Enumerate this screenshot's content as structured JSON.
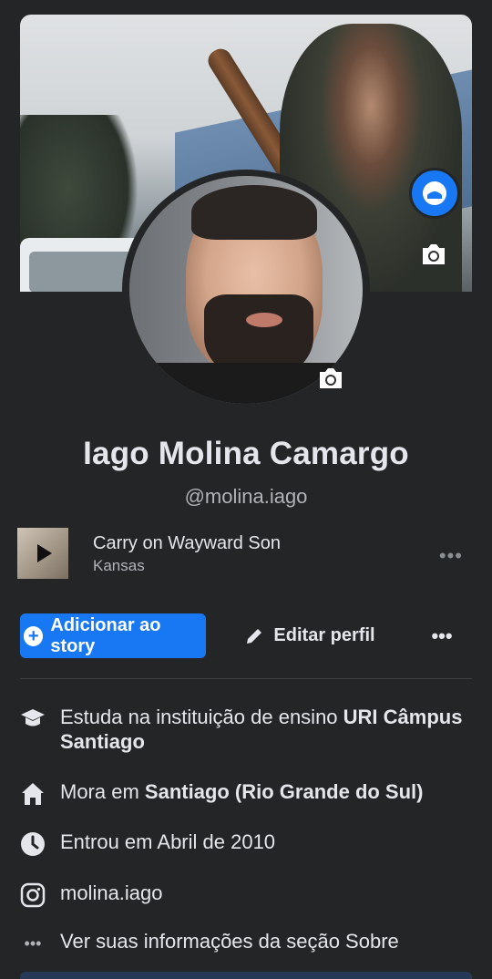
{
  "profile": {
    "name": "Iago Molina Camargo",
    "handle": "@molina.iago"
  },
  "music": {
    "song": "Carry on Wayward Son",
    "artist": "Kansas",
    "more_icon": "more-horizontal-icon"
  },
  "actions": {
    "add_story": "Adicionar ao story",
    "edit_profile": "Editar perfil",
    "more": "•••"
  },
  "info": {
    "study_prefix": "Estuda na instituição de ensino ",
    "study_place": "URI Câmpus Santiago",
    "lives_prefix": "Mora em ",
    "lives_place": "Santiago (Rio Grande do Sul)",
    "joined": "Entrou em Abril de 2010",
    "instagram": "molina.iago",
    "about": "Ver suas informações da seção Sobre"
  },
  "colors": {
    "background": "#242526",
    "accent": "#1877f2",
    "text_primary": "#e4e6eb",
    "text_secondary": "#b0b3b8"
  }
}
